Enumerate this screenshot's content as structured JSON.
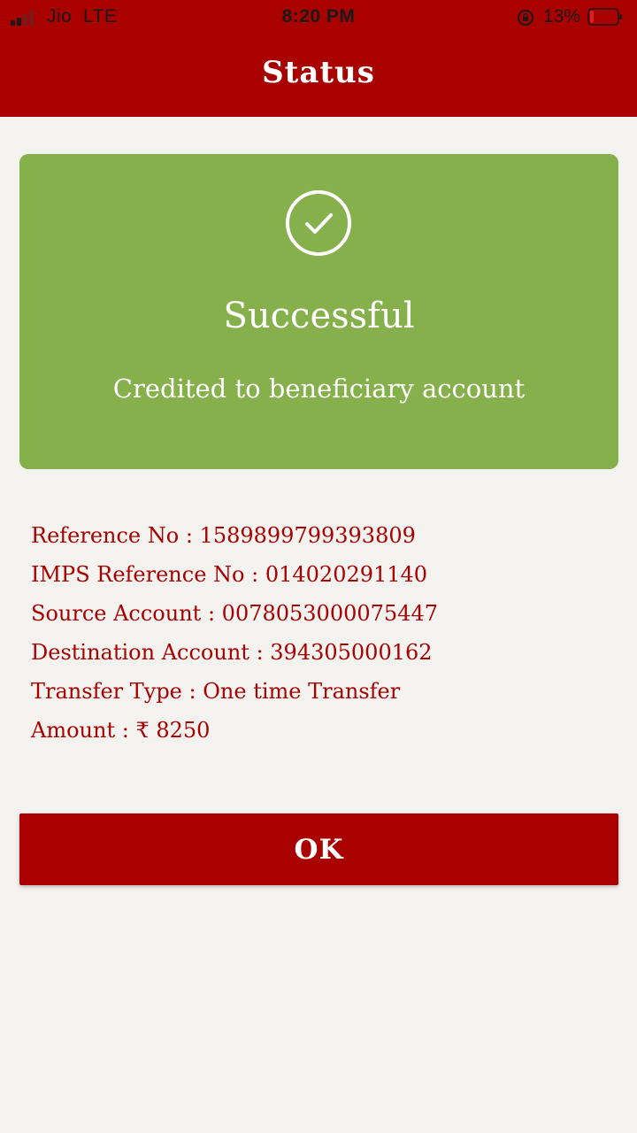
{
  "status_bar": {
    "carrier": "Jio",
    "network": "LTE",
    "time": "8:20 PM",
    "battery_percent": "13%",
    "signal_bars_filled": 2,
    "signal_bars_total": 4,
    "battery_level": 0.13,
    "icons": [
      "signal-icon",
      "orientation-lock-icon",
      "battery-icon"
    ],
    "battery_color": "#e02020"
  },
  "header": {
    "title": "Status",
    "background_color": "#a90000"
  },
  "result": {
    "icon": "check-circle-icon",
    "title": "Successful",
    "subtitle": "Credited to beneficiary account",
    "card_color": "#86b04b"
  },
  "details": [
    {
      "label": "Reference No",
      "value": "1589899799393809"
    },
    {
      "label": "IMPS Reference No",
      "value": "014020291140"
    },
    {
      "label": "Source Account",
      "value": "0078053000075447"
    },
    {
      "label": "Destination Account",
      "value": "394305000162"
    },
    {
      "label": "Transfer Type",
      "value": "One time Transfer"
    },
    {
      "label": "Amount",
      "value": "₹ 8250"
    }
  ],
  "actions": {
    "ok_label": "OK"
  },
  "colors": {
    "accent": "#a90000",
    "success": "#86b04b",
    "background": "#f5f3f0"
  }
}
